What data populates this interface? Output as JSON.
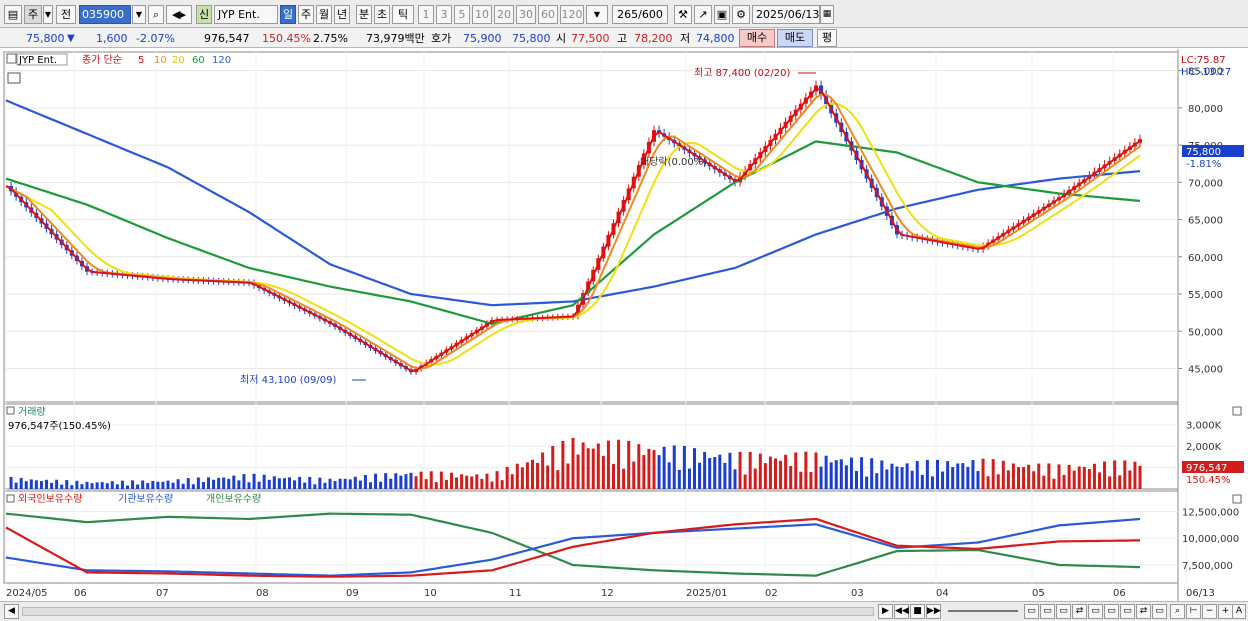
{
  "toolbar": {
    "period_primary": "주",
    "before_label": "전",
    "code": "035900",
    "new_label": "신",
    "stock_name": "JYP Ent.",
    "periods": [
      "일",
      "주",
      "월",
      "년",
      "분",
      "초",
      "틱"
    ],
    "active_period": "일",
    "minute_options": [
      "1",
      "3",
      "5",
      "10",
      "20",
      "30",
      "60",
      "120"
    ],
    "count": "265/600",
    "date": "2025/06/13"
  },
  "quote": {
    "price": "75,800",
    "change": "1,600",
    "change_pct": "-2.07%",
    "volume": "976,547",
    "volume_ratio": "150.45%",
    "turnover": "2.75%",
    "amount": "73,979백만",
    "ask_label": "호가",
    "ask": "75,900",
    "bid": "75,800",
    "open_label": "시",
    "open": "77,500",
    "high_label": "고",
    "high": "78,200",
    "low_label": "저",
    "low": "74,800",
    "buy_label": "매수",
    "sell_label": "매도",
    "avg_label": "평"
  },
  "price_panel": {
    "stock_label": "JYP Ent.",
    "legend_prefix": "종가 단순",
    "ma_periods": [
      "5",
      "10",
      "20",
      "60",
      "120"
    ],
    "ma_colors": [
      "#e01010",
      "#ee8a1e",
      "#f0e010",
      "#1e9a3a",
      "#2a5ad8"
    ],
    "lc": "LC:75.87",
    "hc": "HC:-13.27",
    "price_tag": "75,800",
    "price_tag_pct": "-1.81%",
    "dividend_note": "배당락(0.00%)",
    "max_note": "최고 87,400 (02/20)",
    "min_note": "최저 43,100 (09/09)",
    "y_ticks": [
      "85,000",
      "80,000",
      "75,000",
      "70,000",
      "65,000",
      "60,000",
      "55,000",
      "50,000",
      "45,000"
    ]
  },
  "volume_panel": {
    "title": "거래량",
    "value_label": "976,547주(150.45%)",
    "y_ticks": [
      "3,000K",
      "2,000K",
      "1,000K"
    ],
    "tag": "976,547",
    "tag_pct": "150.45%"
  },
  "holdings_panel": {
    "series_names": [
      "외국인보유수량",
      "기관보유수량",
      "개인보유수량"
    ],
    "series_colors": [
      "#d81a1a",
      "#2a5ad8",
      "#2e8a4a"
    ],
    "y_ticks": [
      "12,500,000",
      "10,000,000",
      "7,500,000"
    ]
  },
  "x_axis": {
    "labels": [
      "2024/05",
      "06",
      "07",
      "08",
      "09",
      "10",
      "11",
      "12",
      "2025/01",
      "02",
      "03",
      "04",
      "05",
      "06",
      "06/13"
    ]
  },
  "chart_data": {
    "type": "line",
    "subtype": "candlestick-with-moving-averages",
    "ylim": [
      40500,
      87500
    ],
    "close_series": {
      "x": [
        "2024/05",
        "06",
        "07",
        "08",
        "09",
        "10",
        "11",
        "12",
        "2025/01",
        "02",
        "03",
        "04",
        "05",
        "06",
        "06/13"
      ],
      "values": [
        69500,
        58000,
        57000,
        56500,
        51000,
        44500,
        51500,
        52000,
        77000,
        70000,
        83000,
        63000,
        61000,
        68000,
        75800
      ]
    },
    "ma120": [
      81000,
      76500,
      72000,
      66000,
      59000,
      55000,
      53500,
      54000,
      56000,
      58500,
      63000,
      66500,
      69000,
      70500,
      71500
    ],
    "ma60": [
      70500,
      67000,
      62500,
      58500,
      56000,
      54000,
      51000,
      53500,
      63000,
      70000,
      75500,
      74000,
      70000,
      68500,
      67500
    ],
    "volume_K": [
      400,
      250,
      300,
      500,
      350,
      600,
      500,
      1700,
      1500,
      1200,
      1200,
      900,
      1000,
      800,
      976
    ],
    "holdings": {
      "foreign": [
        11000000,
        6800000,
        6700000,
        6500000,
        6400000,
        6500000,
        7000000,
        9200000,
        10500000,
        11300000,
        11800000,
        9300000,
        9000000,
        9700000,
        9800000
      ],
      "institution": [
        8200000,
        7000000,
        6900000,
        6700000,
        6500000,
        6800000,
        8000000,
        10000000,
        10500000,
        10900000,
        11300000,
        9100000,
        9600000,
        11200000,
        11800000
      ],
      "individual": [
        12300000,
        11500000,
        12000000,
        11800000,
        12300000,
        12200000,
        10500000,
        7500000,
        7000000,
        6700000,
        6500000,
        8800000,
        8900000,
        7500000,
        7300000
      ]
    }
  }
}
